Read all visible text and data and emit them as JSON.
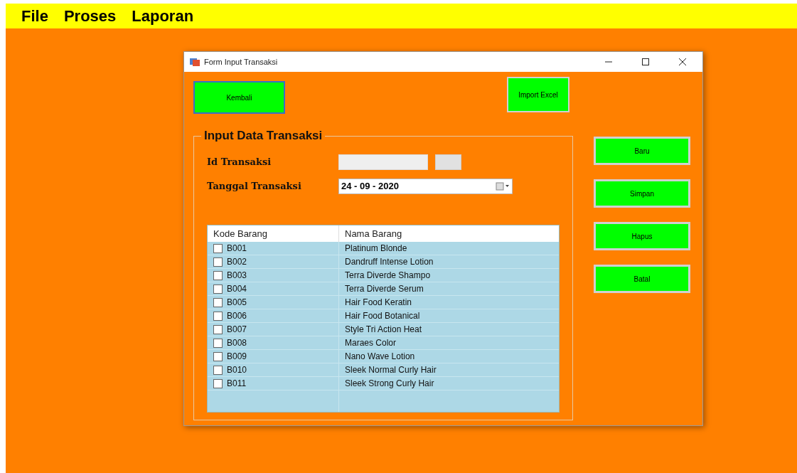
{
  "menu": [
    "File",
    "Proses",
    "Laporan"
  ],
  "window": {
    "title": "Form Input Transaksi"
  },
  "top_buttons": [
    "Kembali",
    "Import Excel"
  ],
  "group": {
    "title": "Input Data Transaksi",
    "fields": [
      {
        "label": "Id Transaksi",
        "kind": "text"
      },
      {
        "label": "Tanggal Transaksi",
        "kind": "date",
        "value": "24 - 09 - 2020"
      }
    ]
  },
  "table": {
    "columns": [
      "Kode Barang",
      "Nama Barang"
    ],
    "rows": [
      {
        "code": "B001",
        "name": "Platinum Blonde",
        "checked": false
      },
      {
        "code": "B002",
        "name": "Dandruff Intense Lotion",
        "checked": false
      },
      {
        "code": "B003",
        "name": "Terra Diverde Shampo",
        "checked": false
      },
      {
        "code": "B004",
        "name": "Terra Diverde Serum",
        "checked": false
      },
      {
        "code": "B005",
        "name": "Hair Food Keratin",
        "checked": false
      },
      {
        "code": "B006",
        "name": "Hair Food Botanical",
        "checked": false
      },
      {
        "code": "B007",
        "name": "Style Tri Action Heat",
        "checked": false
      },
      {
        "code": "B008",
        "name": "Maraes Color",
        "checked": false
      },
      {
        "code": "B009",
        "name": "Nano Wave Lotion",
        "checked": false
      },
      {
        "code": "B010",
        "name": "Sleek Normal Curly Hair",
        "checked": false
      },
      {
        "code": "B011",
        "name": "Sleek Strong Curly Hair",
        "checked": false
      }
    ]
  },
  "side_buttons": [
    "Baru",
    "Simpan",
    "Hapus",
    "Batal"
  ]
}
